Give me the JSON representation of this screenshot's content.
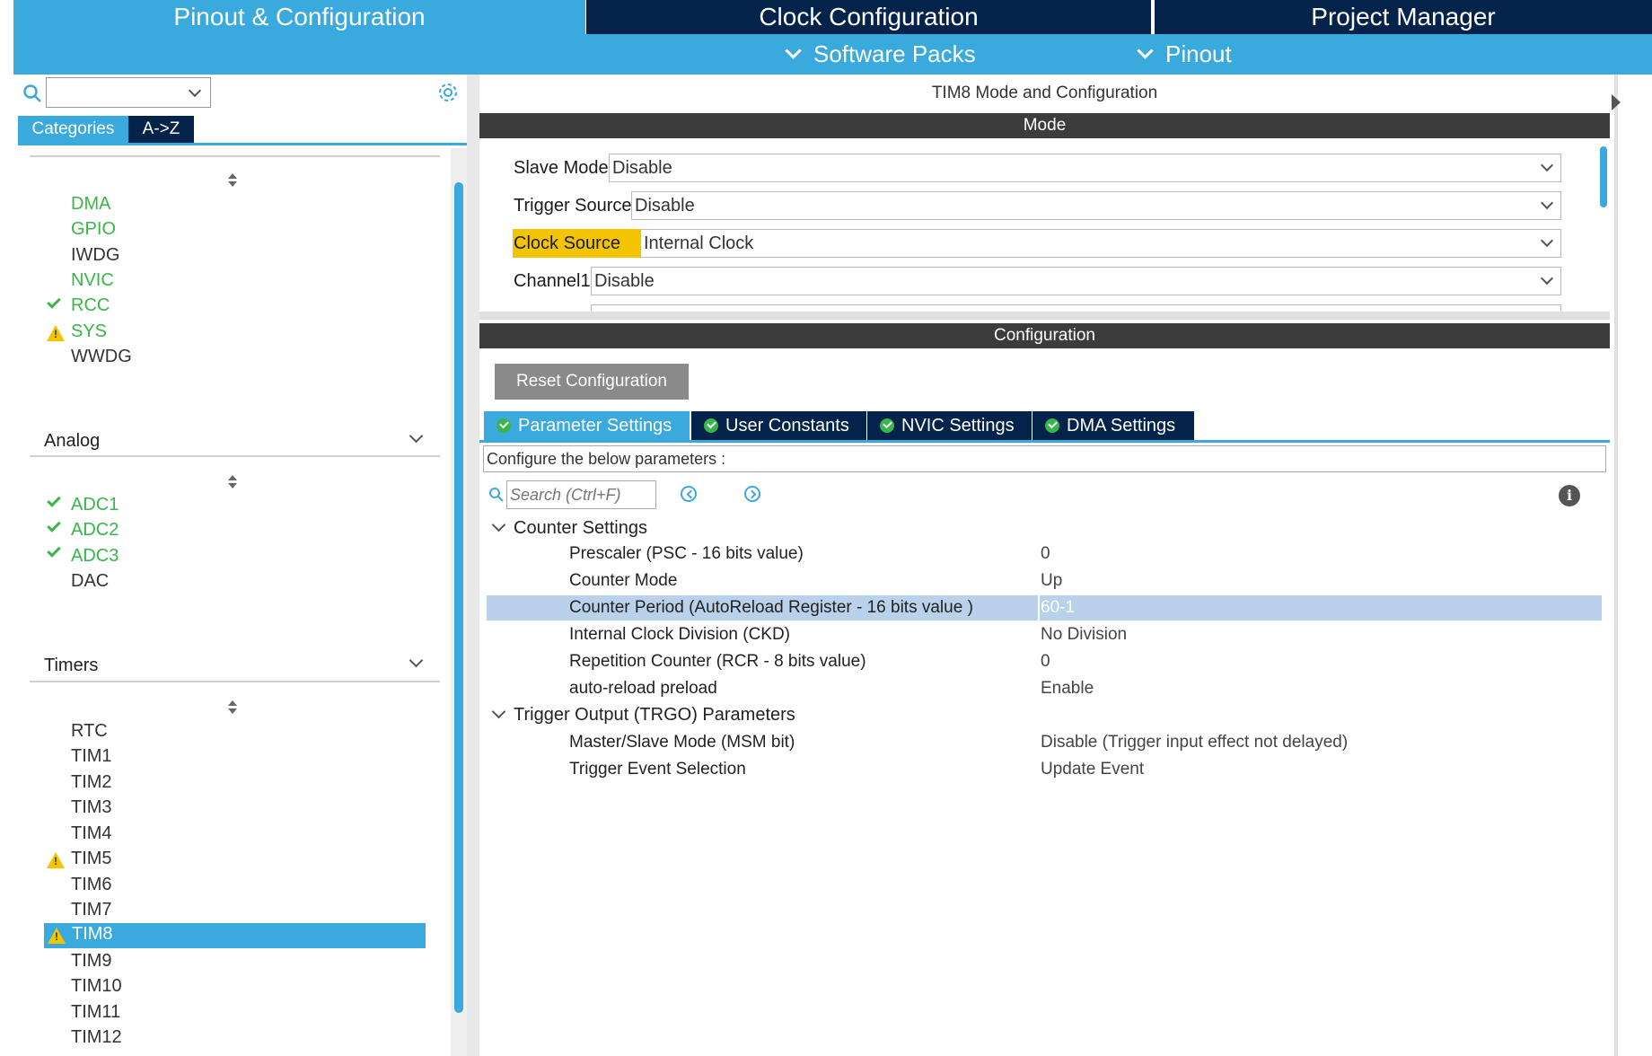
{
  "top_tabs": [
    "Pinout & Configuration",
    "Clock Configuration",
    "Project Manager"
  ],
  "sub_menu": [
    "Software Packs",
    "Pinout"
  ],
  "left": {
    "tabs": [
      "Categories",
      "A->Z"
    ],
    "system_core_items": [
      {
        "label": "DMA",
        "status": "configured"
      },
      {
        "label": "GPIO",
        "status": "configured"
      },
      {
        "label": "IWDG",
        "status": "none"
      },
      {
        "label": "NVIC",
        "status": "configured"
      },
      {
        "label": "RCC",
        "status": "ok"
      },
      {
        "label": "SYS",
        "status": "warning"
      },
      {
        "label": "WWDG",
        "status": "none"
      }
    ],
    "analog_title": "Analog",
    "analog_items": [
      {
        "label": "ADC1",
        "status": "ok"
      },
      {
        "label": "ADC2",
        "status": "ok"
      },
      {
        "label": "ADC3",
        "status": "ok"
      },
      {
        "label": "DAC",
        "status": "none"
      }
    ],
    "timers_title": "Timers",
    "timer_items": [
      {
        "label": "RTC",
        "status": "none"
      },
      {
        "label": "TIM1",
        "status": "none"
      },
      {
        "label": "TIM2",
        "status": "none"
      },
      {
        "label": "TIM3",
        "status": "none"
      },
      {
        "label": "TIM4",
        "status": "none"
      },
      {
        "label": "TIM5",
        "status": "warning"
      },
      {
        "label": "TIM6",
        "status": "none"
      },
      {
        "label": "TIM7",
        "status": "none"
      },
      {
        "label": "TIM8",
        "status": "warning",
        "selected": true
      },
      {
        "label": "TIM9",
        "status": "none"
      },
      {
        "label": "TIM10",
        "status": "none"
      },
      {
        "label": "TIM11",
        "status": "none"
      },
      {
        "label": "TIM12",
        "status": "none"
      }
    ]
  },
  "right": {
    "panel_title": "TIM8 Mode and Configuration",
    "mode_header": "Mode",
    "mode_rows": [
      {
        "label": "Slave Mode",
        "value": "Disable"
      },
      {
        "label": "Trigger Source",
        "value": "Disable"
      },
      {
        "label": "Clock Source",
        "value": "Internal Clock"
      },
      {
        "label": "Channel1",
        "value": "Disable"
      }
    ],
    "config_header": "Configuration",
    "reset_button": "Reset Configuration",
    "tabs": [
      "Parameter Settings",
      "User Constants",
      "NVIC Settings",
      "DMA Settings"
    ],
    "configure_text": "Configure the below parameters :",
    "search_placeholder": "Search (Ctrl+F)",
    "groups": [
      {
        "label": "Counter Settings",
        "params": [
          {
            "name": "Prescaler (PSC - 16 bits value)",
            "value": "0"
          },
          {
            "name": "Counter Mode",
            "value": "Up"
          },
          {
            "name": "Counter Period (AutoReload Register - 16 bits value )",
            "value": "60-1",
            "selected": true
          },
          {
            "name": "Internal Clock Division (CKD)",
            "value": "No Division"
          },
          {
            "name": "Repetition Counter (RCR - 8 bits value)",
            "value": "0"
          },
          {
            "name": "auto-reload preload",
            "value": "Enable"
          }
        ]
      },
      {
        "label": "Trigger Output (TRGO) Parameters",
        "params": [
          {
            "name": "Master/Slave Mode (MSM bit)",
            "value": "Disable (Trigger input effect not delayed)"
          },
          {
            "name": "Trigger Event Selection",
            "value": "Update Event"
          }
        ]
      }
    ]
  },
  "colors": {
    "accent_blue": "#3aa9de",
    "navy": "#03234b",
    "green": "#3ab54a",
    "warning_yellow": "#f5c400",
    "highlight_row": "#b9d1ea"
  }
}
